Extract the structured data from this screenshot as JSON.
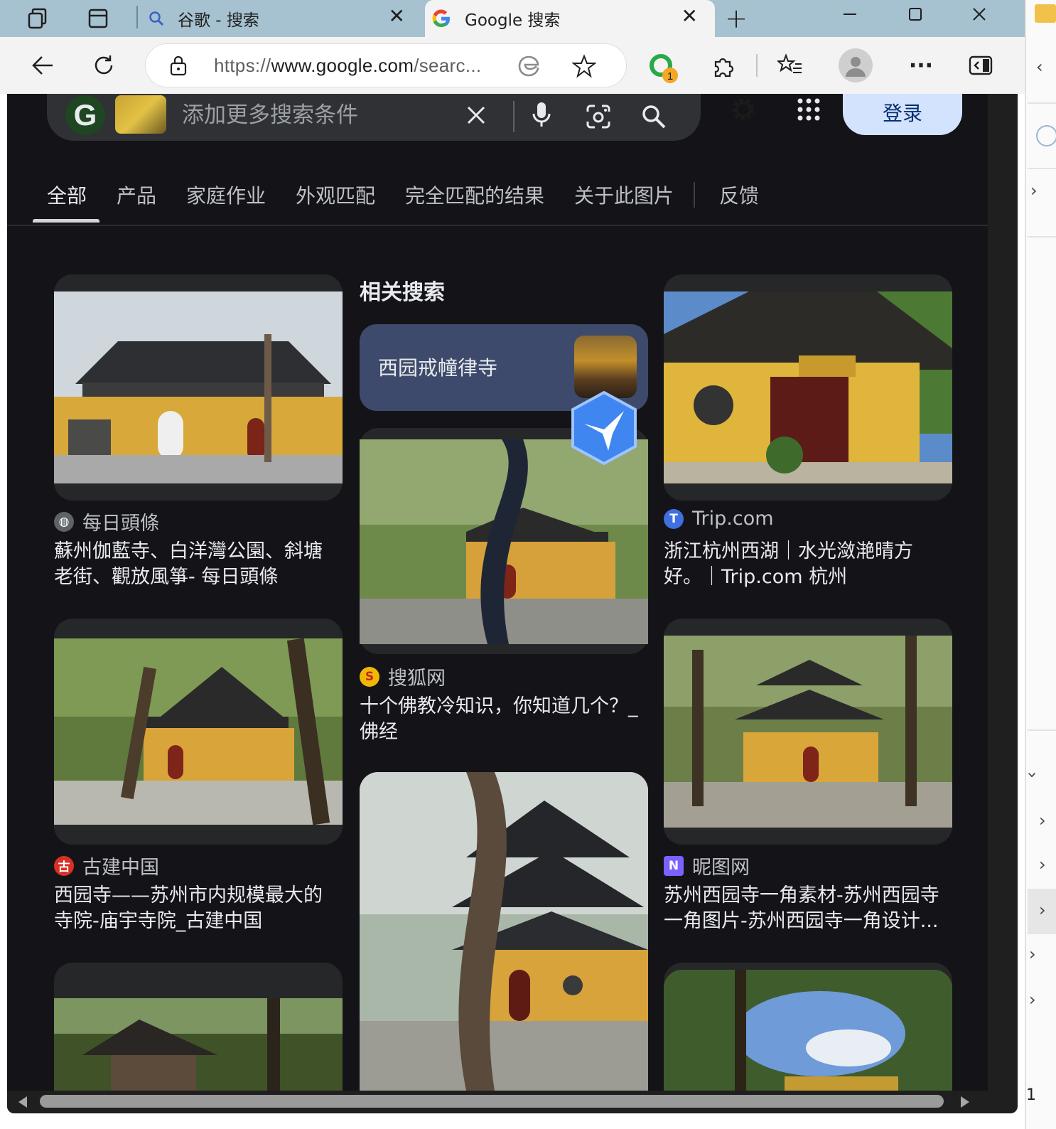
{
  "browser": {
    "tabs": [
      {
        "title": "谷歌 - 搜索",
        "active": false,
        "icon": "search-icon"
      },
      {
        "title": "Google 搜索",
        "active": true,
        "icon": "google-g-icon"
      }
    ],
    "address": {
      "scheme": "https://",
      "host": "www.google.com",
      "path": "/searc..."
    },
    "extension_badge": "1"
  },
  "search": {
    "placeholder": "添加更多搜索条件",
    "login_label": "登录"
  },
  "result_tabs": [
    {
      "label": "全部",
      "active": true
    },
    {
      "label": "产品",
      "active": false
    },
    {
      "label": "家庭作业",
      "active": false
    },
    {
      "label": "外观匹配",
      "active": false
    },
    {
      "label": "完全匹配的结果",
      "active": false
    },
    {
      "label": "关于此图片",
      "active": false
    },
    {
      "label": "反馈",
      "active": false
    }
  ],
  "related": {
    "heading": "相关搜索",
    "chip_label": "西园戒幢律寺"
  },
  "results": [
    {
      "source": "每日頭條",
      "title_line1": "蘇州伽藍寺、白洋灣公園、斜塘",
      "title_line2": "老街、觀放風箏- 每日頭條",
      "favicon_color": "#5f6368"
    },
    {
      "source": "Trip.com",
      "title_line1": "浙江杭州西湖｜水光潋滟晴方",
      "title_line2": "好。｜Trip.com 杭州",
      "favicon_color": "#3f6fe0"
    },
    {
      "source": "搜狐网",
      "title_line1": "十个佛教冷知识，你知道几个？_",
      "title_line2": "佛经",
      "favicon_color": "#f2b705"
    },
    {
      "source": "古建中国",
      "title_line1": "西园寺——苏州市内规模最大的",
      "title_line2": "寺院-庙宇寺院_古建中国",
      "favicon_color": "#d93025"
    },
    {
      "source": "昵图网",
      "title_line1": "苏州西园寺一角素材-苏州西园寺",
      "title_line2": "一角图片-苏州西园寺一角设计...",
      "favicon_color": "#7b61ff"
    }
  ],
  "side_panel": {
    "bottom_digit": "1"
  }
}
